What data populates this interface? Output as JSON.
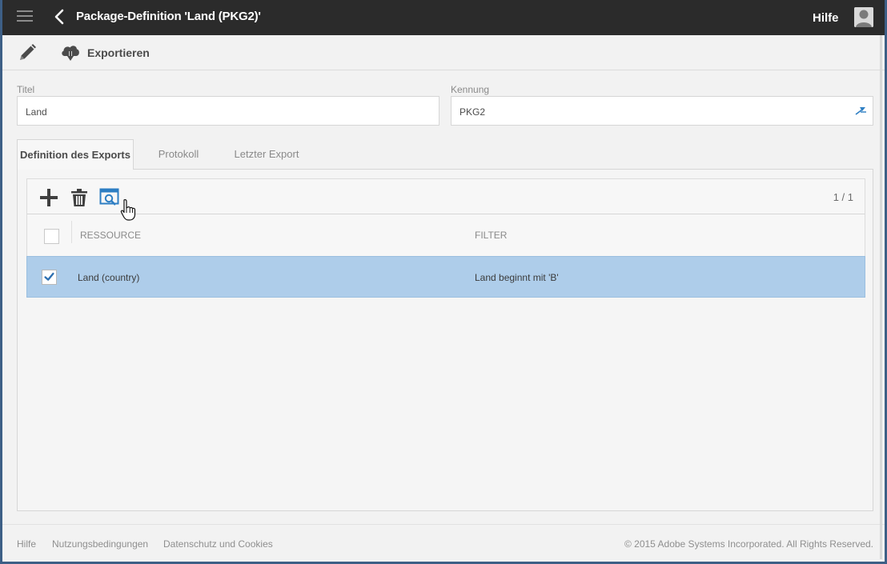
{
  "header": {
    "title": "Package-Definition 'Land (PKG2)'",
    "help_label": "Hilfe"
  },
  "toolbar": {
    "export_label": "Exportieren"
  },
  "form": {
    "title_label": "Titel",
    "title_value": "Land",
    "id_label": "Kennung",
    "id_value": "PKG2"
  },
  "tabs": [
    {
      "label": "Definition des Exports",
      "active": true
    },
    {
      "label": "Protokoll",
      "active": false
    },
    {
      "label": "Letzter Export",
      "active": false
    }
  ],
  "grid": {
    "pager": "1 / 1",
    "columns": [
      "RESSOURCE",
      "FILTER"
    ],
    "rows": [
      {
        "resource": "Land (country)",
        "filter": "Land beginnt mit 'B'",
        "checked": true,
        "selected": true
      }
    ]
  },
  "footer": {
    "links": [
      "Hilfe",
      "Nutzungsbedingungen",
      "Datenschutz und Cookies"
    ],
    "copyright": "© 2015 Adobe Systems Incorporated. All Rights Reserved."
  },
  "colors": {
    "topbar": "#2b2b2b",
    "selected_row": "#aecdea",
    "accent_blue": "#2d7ec3",
    "window_border": "#3d5f86"
  },
  "icons": [
    "menu-icon",
    "back-icon",
    "avatar-icon",
    "pencil-icon",
    "cloud-download-icon",
    "pin-icon",
    "plus-icon",
    "trash-icon",
    "preview-icon",
    "hand-cursor-icon"
  ]
}
